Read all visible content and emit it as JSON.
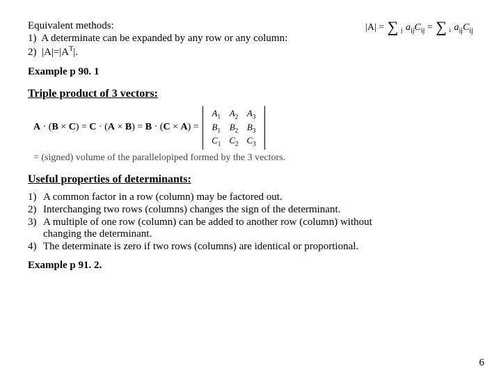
{
  "equiv": {
    "title": "Equivalent methods:",
    "item1_n": "1)",
    "item1_t": "A determinate can be expanded by any row or any column:",
    "item2_n": "2)",
    "item2_prefix": "|A|=|A",
    "item2_sup": "T",
    "item2_suffix": "|."
  },
  "formula_top": {
    "lhs": "|A|",
    "sum1_idx": "j",
    "term1_a": "a",
    "term1_sub": "ij",
    "term1_C": "C",
    "term1_Csub": "ij",
    "sum2_idx": "i",
    "term2_a": "a",
    "term2_sub": "ij",
    "term2_C": "C",
    "term2_Csub": "ij"
  },
  "example1": "Example  p 90. 1",
  "heading_triple": "Triple product of 3 vectors:",
  "triple": {
    "lhs": "A · (B × C) = C · (A × B) = B · (C × A) = ",
    "m": {
      "r1c1a": "A",
      "r1c1s": "1",
      "r1c2a": "A",
      "r1c2s": "2",
      "r1c3a": "A",
      "r1c3s": "3",
      "r2c1a": "B",
      "r2c1s": "1",
      "r2c2a": "B",
      "r2c2s": "2",
      "r2c3a": "B",
      "r2c3s": "3",
      "r3c1a": "C",
      "r3c1s": "1",
      "r3c2a": "C",
      "r3c2s": "2",
      "r3c3a": "C",
      "r3c3s": "3"
    }
  },
  "signed_line": "= (signed) volume of the parallelopiped formed by the 3 vectors.",
  "heading_props": "Useful properties of determinants",
  "heading_props_colon": ":",
  "props": {
    "p1n": "1)",
    "p1": "A common factor in a row (column) may be factored out.",
    "p2n": "2)",
    "p2": "Interchanging two rows (columns) changes the sign of the determinant.",
    "p3n": "3)",
    "p3a": "A multiple of one row (column) can be added to another row (column) without",
    "p3b": "changing the determinant.",
    "p4n": "4)",
    "p4": "The determinate is zero if two rows (columns) are identical or proportional."
  },
  "example2": "Example  p 91. 2.",
  "pagenum": "6"
}
